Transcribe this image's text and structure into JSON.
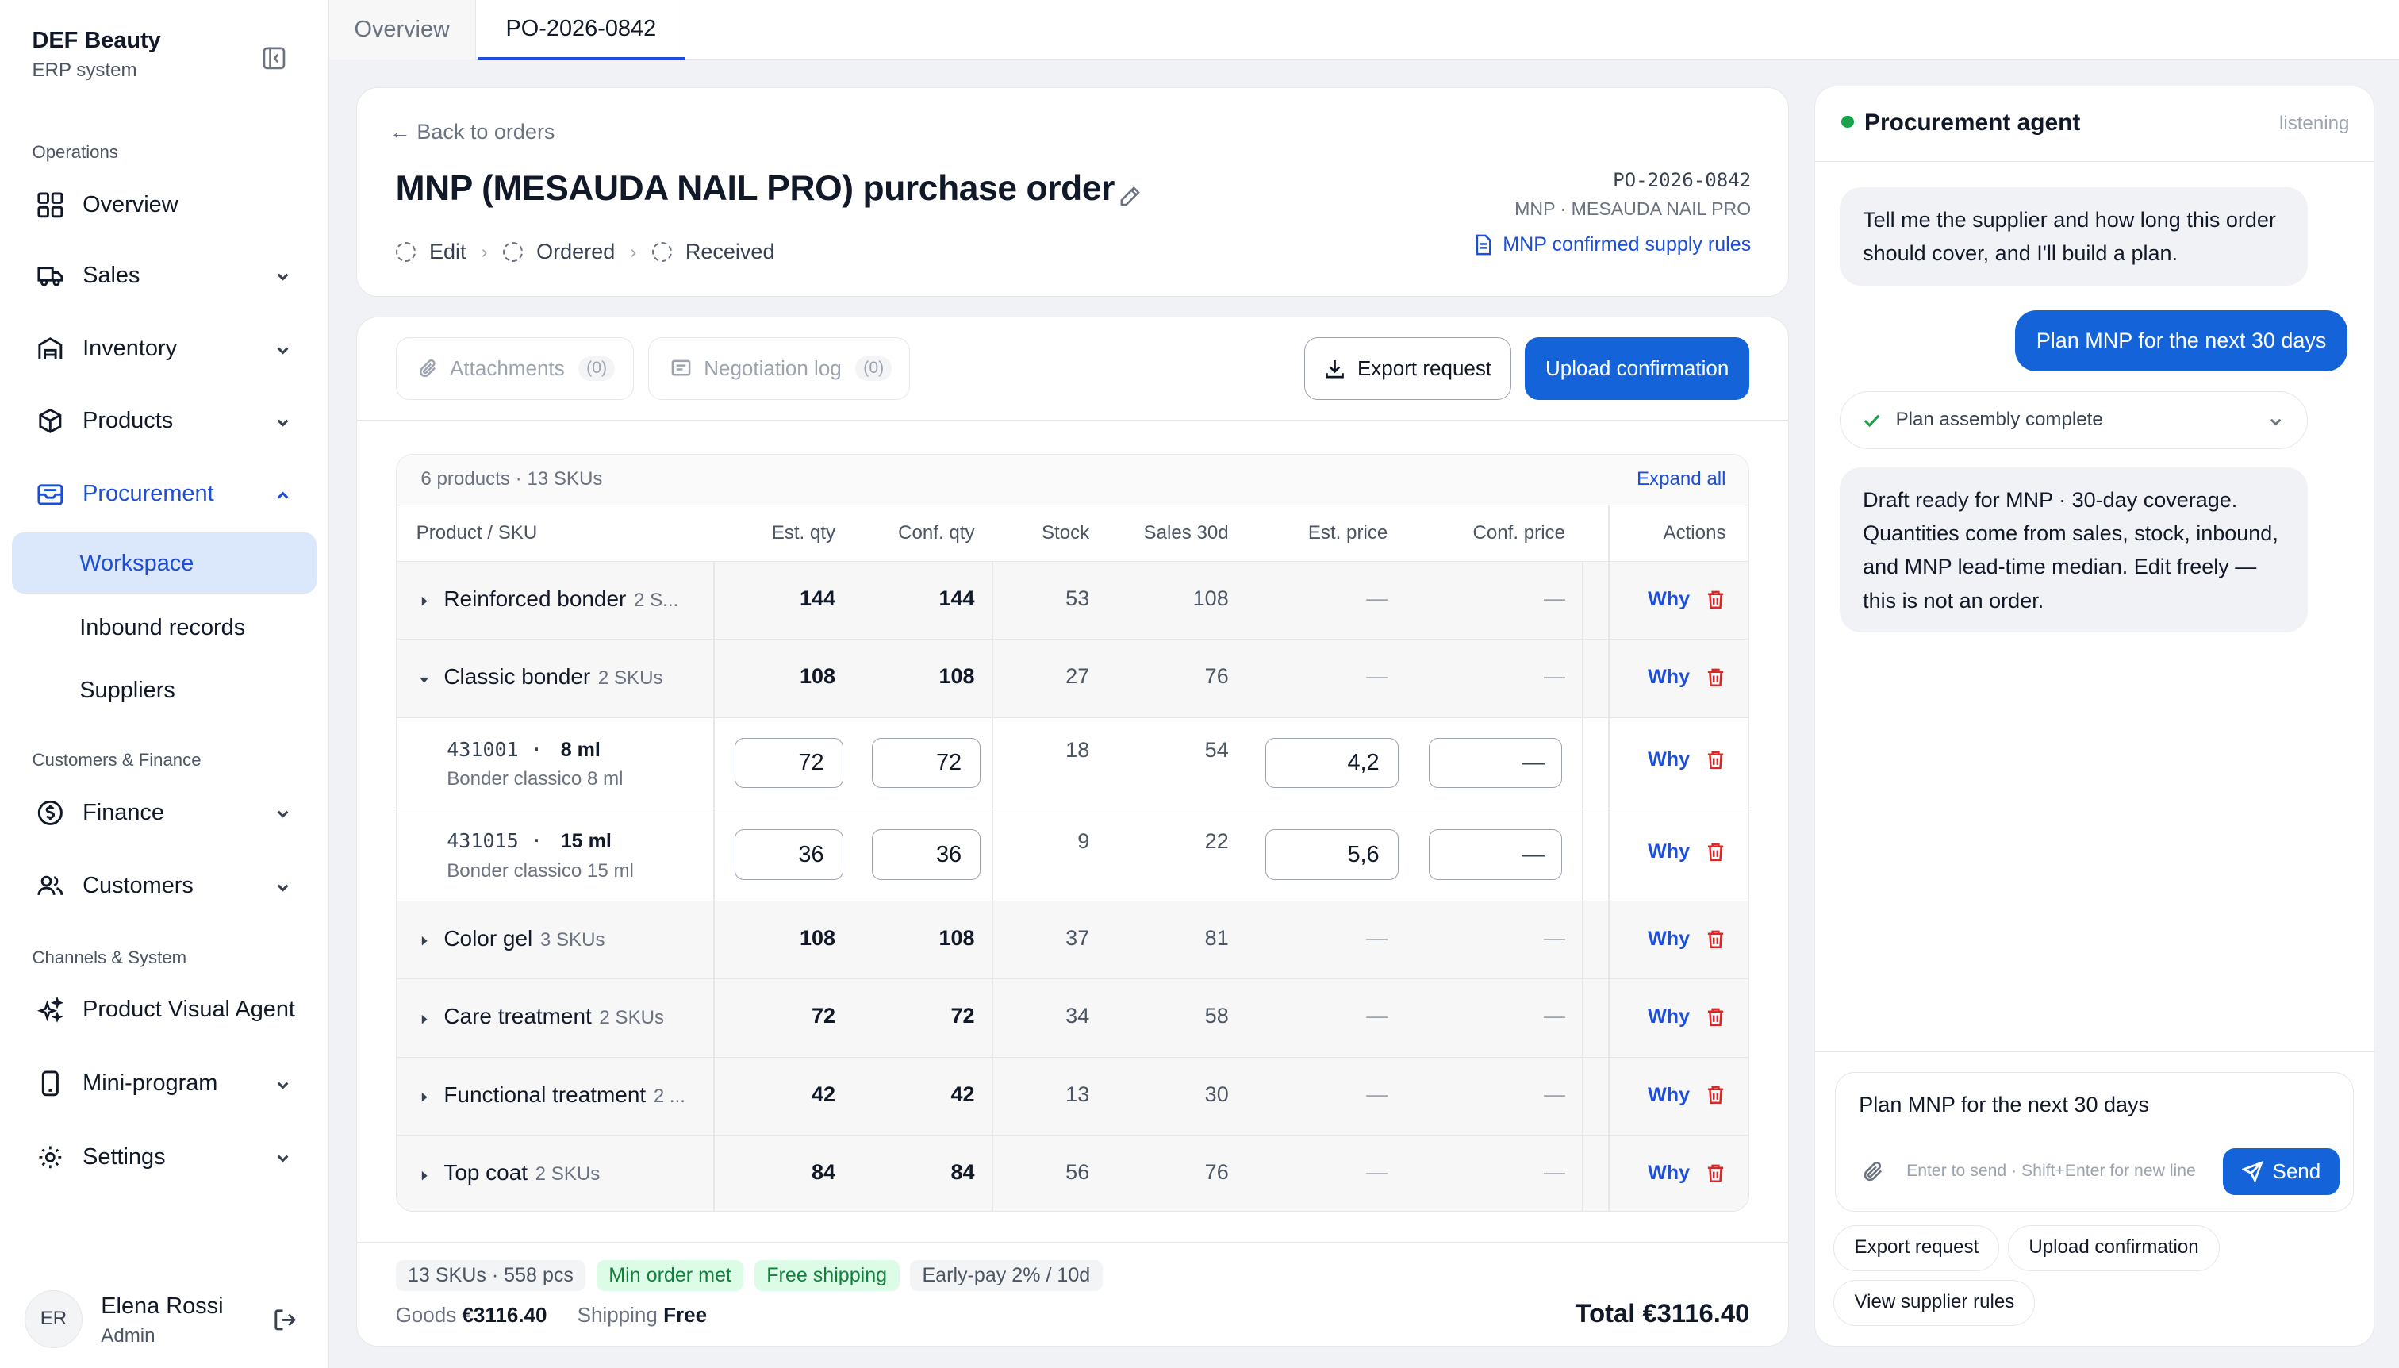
{
  "sidebar": {
    "brand": "DEF Beauty",
    "subtitle": "ERP system",
    "sections": [
      "Operations",
      "Customers & Finance",
      "Channels & System"
    ],
    "nav": {
      "overview": "Overview",
      "sales": "Sales",
      "inventory": "Inventory",
      "products": "Products",
      "procurement": "Procurement",
      "workspace": "Workspace",
      "inbound": "Inbound records",
      "suppliers": "Suppliers",
      "finance": "Finance",
      "customers": "Customers",
      "pva": "Product Visual Agent",
      "mini": "Mini-program",
      "settings": "Settings"
    },
    "user": {
      "initials": "ER",
      "name": "Elena Rossi",
      "role": "Admin"
    }
  },
  "tabs": [
    "Overview",
    "PO-2026-0842"
  ],
  "header": {
    "back": "← Back to orders",
    "title": "MNP (MESAUDA NAIL PRO) purchase order",
    "steps": [
      "Edit",
      "Ordered",
      "Received"
    ],
    "po_id": "PO-2026-0842",
    "supplier": "MNP · MESAUDA NAIL PRO",
    "rules_link": "MNP confirmed supply rules"
  },
  "toolbar": {
    "attachments": "Attachments",
    "attachments_count": "(0)",
    "negotiation": "Negotiation log",
    "negotiation_count": "(0)",
    "export": "Export request",
    "upload": "Upload confirmation"
  },
  "table": {
    "summary": "6 products · 13 SKUs",
    "expand_all": "Expand all",
    "columns": [
      "Product / SKU",
      "Est. qty",
      "Conf. qty",
      "Stock",
      "Sales 30d",
      "Est. price",
      "Conf. price",
      "Actions"
    ],
    "why": "Why",
    "groups": [
      {
        "name": "Reinforced bonder",
        "skus": "2 S...",
        "est_qty": "144",
        "conf_qty": "144",
        "stock": "53",
        "sales": "108",
        "est_price": "—",
        "conf_price": "—"
      },
      {
        "name": "Classic bonder",
        "skus": "2 SKUs",
        "est_qty": "108",
        "conf_qty": "108",
        "stock": "27",
        "sales": "76",
        "est_price": "—",
        "conf_price": "—"
      },
      {
        "name": "Color gel",
        "skus": "3 SKUs",
        "est_qty": "108",
        "conf_qty": "108",
        "stock": "37",
        "sales": "81",
        "est_price": "—",
        "conf_price": "—"
      },
      {
        "name": "Care treatment",
        "skus": "2 SKUs",
        "est_qty": "72",
        "conf_qty": "72",
        "stock": "34",
        "sales": "58",
        "est_price": "—",
        "conf_price": "—"
      },
      {
        "name": "Functional treatment",
        "skus": "2 ...",
        "est_qty": "42",
        "conf_qty": "42",
        "stock": "13",
        "sales": "30",
        "est_price": "—",
        "conf_price": "—"
      },
      {
        "name": "Top coat",
        "skus": "2 SKUs",
        "est_qty": "84",
        "conf_qty": "84",
        "stock": "56",
        "sales": "76",
        "est_price": "—",
        "conf_price": "—"
      }
    ],
    "skus": [
      {
        "code": "431001",
        "volume": "8 ml",
        "desc": "Bonder classico 8 ml",
        "est_qty": "72",
        "conf_qty": "72",
        "stock": "18",
        "sales": "54",
        "est_price": "4,2",
        "conf_price": "—"
      },
      {
        "code": "431015",
        "volume": "15 ml",
        "desc": "Bonder classico 15 ml",
        "est_qty": "36",
        "conf_qty": "36",
        "stock": "9",
        "sales": "22",
        "est_price": "5,6",
        "conf_price": "—"
      }
    ]
  },
  "footer": {
    "tags": [
      "13 SKUs · 558 pcs",
      "Min order met",
      "Free shipping",
      "Early-pay 2% / 10d"
    ],
    "goods_label": "Goods",
    "goods_value": "€3116.40",
    "shipping_label": "Shipping",
    "shipping_value": "Free",
    "total": "Total €3116.40"
  },
  "agent": {
    "title": "Procurement agent",
    "status": "listening",
    "messages": [
      "Tell me the supplier and how long this order should cover, and I'll build a plan.",
      "Plan MNP for the next 30 days",
      "Draft ready for MNP · 30-day coverage. Quantities come from sales, stock, inbound, and MNP lead-time median. Edit freely — this is not an order."
    ],
    "plan_status": "Plan assembly complete",
    "input_value": "Plan MNP for the next 30 days",
    "hint": "Enter to send · Shift+Enter for new line",
    "send": "Send",
    "quick_actions": [
      "Export request",
      "Upload confirmation",
      "View supplier rules"
    ]
  },
  "colors": {
    "accent": "#1563d9",
    "link": "#1d4ed8",
    "danger": "#dc2626",
    "success": "#15803d"
  }
}
